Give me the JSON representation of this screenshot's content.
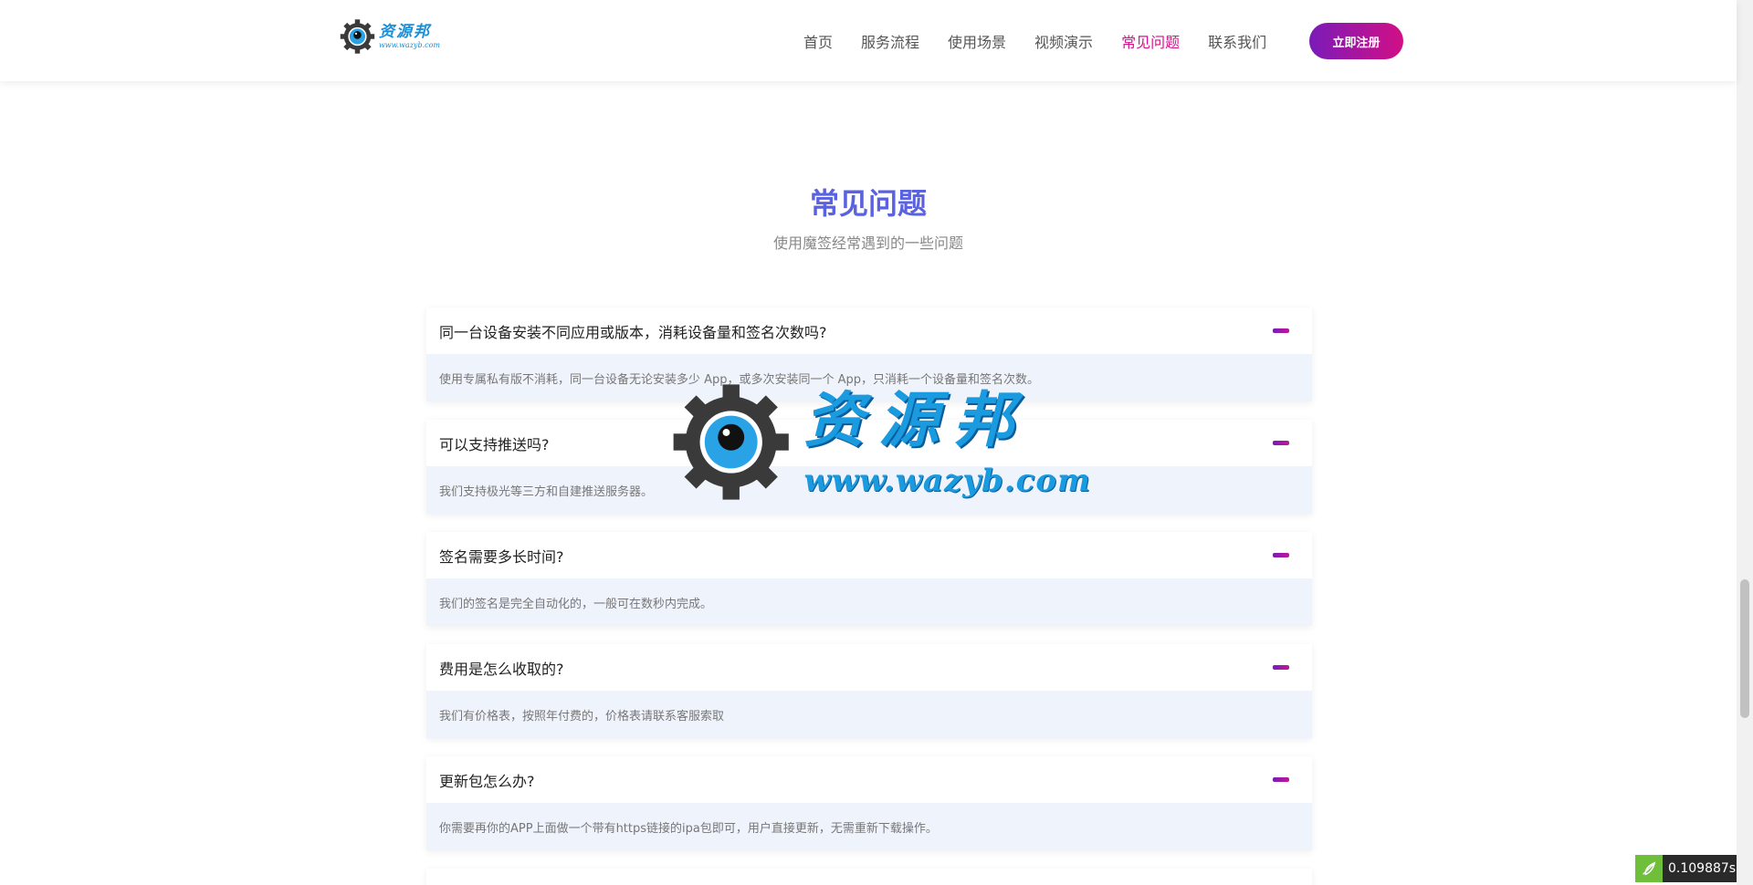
{
  "header": {
    "logo_cn": "资源邦",
    "logo_url": "www.wazyb.com",
    "nav": [
      "首页",
      "服务流程",
      "使用场景",
      "视频演示",
      "常见问题",
      "联系我们"
    ],
    "active_nav": "常见问题",
    "register_label": "立即注册"
  },
  "section": {
    "title": "常见问题",
    "subtitle": "使用魔签经常遇到的一些问题"
  },
  "faq": [
    {
      "q": "同一台设备安装不同应用或版本，消耗设备量和签名次数吗?",
      "a": "使用专属私有版不消耗，同一台设备无论安装多少 App，或多次安装同一个 App，只消耗一个设备量和签名次数。"
    },
    {
      "q": "可以支持推送吗?",
      "a": "我们支持极光等三方和自建推送服务器。"
    },
    {
      "q": "签名需要多长时间?",
      "a": "我们的签名是完全自动化的，一般可在数秒内完成。"
    },
    {
      "q": "费用是怎么收取的?",
      "a": "我们有价格表，按照年付费的，价格表请联系客服索取"
    },
    {
      "q": "更新包怎么办?",
      "a": "你需要再你的APP上面做一个带有https链接的ipa包即可，用户直接更新，无需重新下载操作。"
    }
  ],
  "watermark": {
    "cn": "资源邦",
    "url": "www.wazyb.com"
  },
  "perf": {
    "value": "0.109887s"
  },
  "colors": {
    "accent": "#5b62e0",
    "nav_active": "#d6118c",
    "answer_bg": "#eff3fc"
  }
}
